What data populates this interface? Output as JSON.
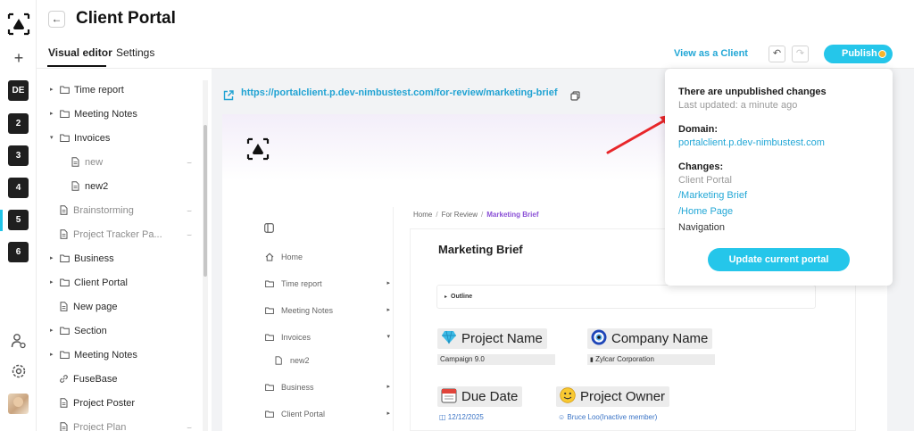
{
  "rail": {
    "workspaces": [
      "DE",
      "2",
      "3",
      "4",
      "5",
      "6"
    ],
    "active_workspace": "5"
  },
  "header": {
    "title": "Client Portal",
    "tabs": [
      "Visual editor",
      "Settings"
    ],
    "view_as_client": "View as a Client",
    "publish": "Publish"
  },
  "tree": {
    "items": [
      {
        "label": "Time report",
        "type": "folder",
        "caret": "right",
        "indent": 0
      },
      {
        "label": "Meeting Notes",
        "type": "folder",
        "caret": "right",
        "indent": 0
      },
      {
        "label": "Invoices",
        "type": "folder",
        "caret": "down",
        "indent": 0
      },
      {
        "label": "new",
        "type": "page",
        "indent": 1,
        "muted": true,
        "hidden_icon": true
      },
      {
        "label": "new2",
        "type": "page",
        "indent": 1
      },
      {
        "label": "Brainstorming",
        "type": "page",
        "indent": 0,
        "muted": true,
        "hidden_icon": true
      },
      {
        "label": "Project Tracker Pa...",
        "type": "page",
        "indent": 0,
        "muted": true,
        "hidden_icon": true
      },
      {
        "label": "Business",
        "type": "folder",
        "caret": "right",
        "indent": 0
      },
      {
        "label": "Client Portal",
        "type": "folder",
        "caret": "right",
        "indent": 0
      },
      {
        "label": "New page",
        "type": "page",
        "indent": 0
      },
      {
        "label": "Section",
        "type": "folder",
        "caret": "right",
        "indent": 0
      },
      {
        "label": "Meeting Notes",
        "type": "folder",
        "caret": "right",
        "indent": 0
      },
      {
        "label": "FuseBase",
        "type": "link",
        "indent": 0
      },
      {
        "label": "Project Poster",
        "type": "page",
        "indent": 0
      },
      {
        "label": "Project Plan",
        "type": "page",
        "indent": 0,
        "muted": true,
        "hidden_icon": true
      }
    ]
  },
  "preview": {
    "url": "https://portalclient.p.dev-nimbustest.com/for-review/marketing-brief",
    "nav": [
      {
        "label": "Home",
        "icon": "home-icon",
        "caret": ""
      },
      {
        "label": "Time report",
        "icon": "folder-icon",
        "caret": "right"
      },
      {
        "label": "Meeting Notes",
        "icon": "folder-icon",
        "caret": "right"
      },
      {
        "label": "Invoices",
        "icon": "folder-icon",
        "caret": "down"
      },
      {
        "label": "new2",
        "icon": "page-icon",
        "caret": "",
        "indent": true
      },
      {
        "label": "Business",
        "icon": "folder-icon",
        "caret": "right"
      },
      {
        "label": "Client Portal",
        "icon": "folder-icon",
        "caret": "right"
      }
    ],
    "breadcrumb": [
      "Home",
      "For Review",
      "Marketing Brief"
    ],
    "doc_title": "Marketing Brief",
    "outline": "Outline",
    "fields": {
      "project_name": {
        "label": "Project Name",
        "value": "Campaign 9.0"
      },
      "company_name": {
        "label": "Company Name",
        "value": "Zylcar Corporation"
      },
      "due_date": {
        "label": "Due Date",
        "value": "12/12/2025"
      },
      "project_owner": {
        "label": "Project Owner",
        "value": "Bruce Loo(Inactive member)"
      }
    }
  },
  "popover": {
    "heading": "There are unpublished changes",
    "last_updated": "Last updated: a minute ago",
    "domain_label": "Domain:",
    "domain": "portalclient.p.dev-nimbustest.com",
    "changes_label": "Changes:",
    "changes": [
      "Client Portal",
      "/Marketing Brief",
      "/Home Page",
      "Navigation"
    ],
    "update_button": "Update current portal"
  },
  "colors": {
    "accent": "#25c6ea",
    "link": "#22a7d6",
    "publish_dot": "#f7b52b",
    "breadcrumb_current": "#8a4fd6",
    "annotation_arrow": "#e8262a"
  }
}
